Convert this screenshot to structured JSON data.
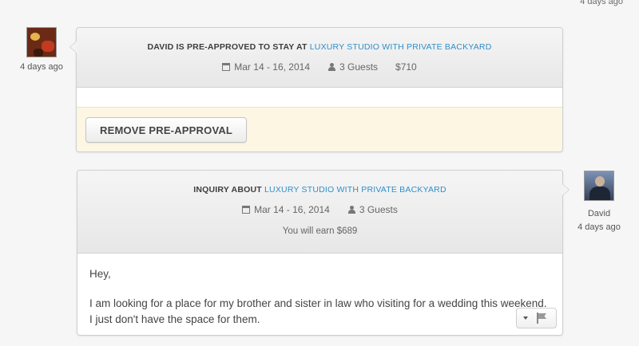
{
  "top_timestamp": "4 days ago",
  "host_message": {
    "timestamp": "4 days ago",
    "title_prefix": "DAVID IS PRE-APPROVED TO STAY AT",
    "listing_link": "Luxury studio with private backyard",
    "dates": "Mar 14 - 16, 2014",
    "guests": "3 Guests",
    "price": "$710",
    "remove_button": "REMOVE PRE-APPROVAL"
  },
  "guest_message": {
    "sender_name": "David",
    "timestamp": "4 days ago",
    "title_prefix": "INQUIRY ABOUT",
    "listing_link": "Luxury studio with private backyard",
    "dates": "Mar 14 - 16, 2014",
    "guests": "3 Guests",
    "earnings": "You will earn $689",
    "body": [
      "Hey,",
      "I am looking for a place for my brother and sister in law who visiting for a wedding this weekend. I just don't have the space for them."
    ]
  },
  "icons": {
    "dates": "calendar-icon",
    "guests": "person-icon",
    "flag": "flag-icon",
    "menu": "caret-down-icon"
  },
  "colors": {
    "link": "#2f8fc9",
    "alert_background": "#fcf6e3"
  }
}
